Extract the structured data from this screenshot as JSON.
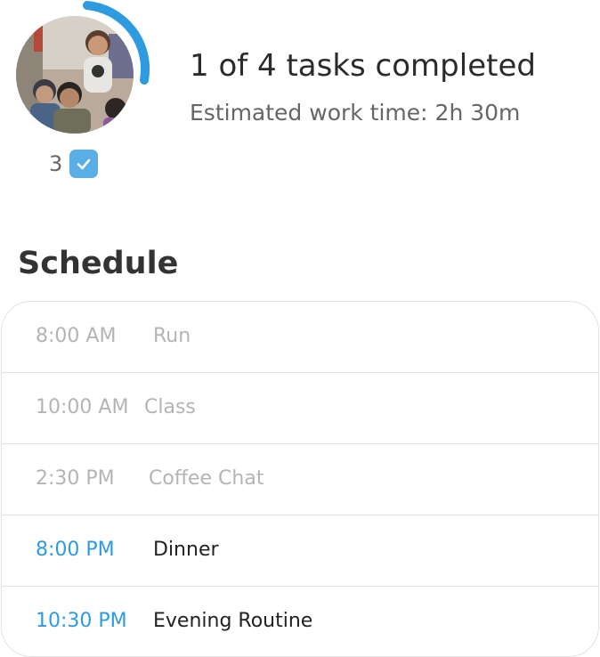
{
  "summary": {
    "avatar_icon": "user-photo",
    "completed_count": "3",
    "check_icon": "check-icon",
    "headline": "1 of 4 tasks completed",
    "progress_fraction": 0.25,
    "estimated_time": "Estimated work time: 2h 30m",
    "accent_color": "#2e9be0"
  },
  "schedule": {
    "title": "Schedule",
    "items": [
      {
        "time": "8:00 AM",
        "name": "Run",
        "status": "past"
      },
      {
        "time": "10:00 AM",
        "name": "Class",
        "status": "past"
      },
      {
        "time": "2:30 PM",
        "name": "Coffee Chat",
        "status": "past"
      },
      {
        "time": "8:00 PM",
        "name": "Dinner",
        "status": "upcoming"
      },
      {
        "time": "10:30 PM",
        "name": "Evening Routine",
        "status": "upcoming"
      }
    ]
  }
}
